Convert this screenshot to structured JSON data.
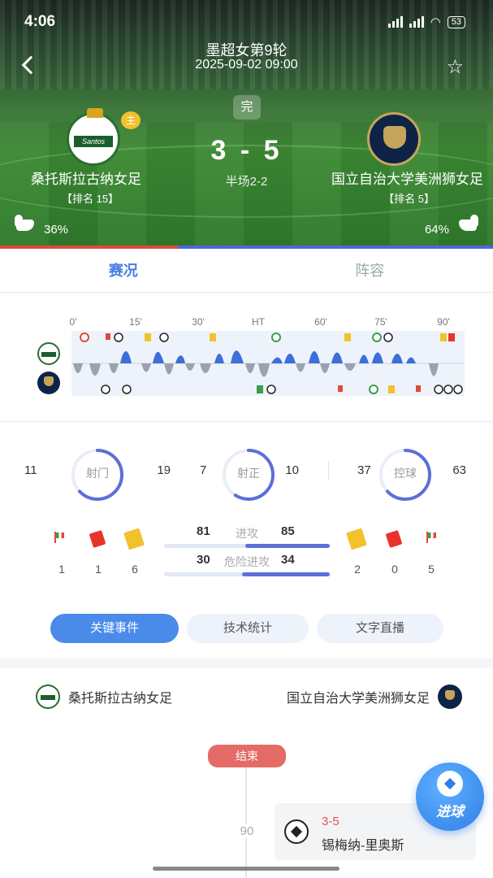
{
  "status_bar": {
    "time": "4:06",
    "battery": "53"
  },
  "header": {
    "league": "墨超女第9轮",
    "datetime": "2025-09-02 09:00",
    "status": "完",
    "score": "3 - 5",
    "halftime": "半场2-2",
    "home": {
      "name": "桑托斯拉古纳女足",
      "rank": "【排名 15】",
      "badge": "主",
      "strength_pct": "36%",
      "logo_text": "Santos"
    },
    "away": {
      "name": "国立自治大学美洲狮女足",
      "rank": "【排名 5】",
      "strength_pct": "64%"
    },
    "possession_split": {
      "home": 0.36,
      "away": 0.64
    }
  },
  "tabs": [
    {
      "label": "赛况",
      "active": true
    },
    {
      "label": "阵容",
      "active": false
    }
  ],
  "timeline": {
    "labels": [
      "0'",
      "15'",
      "30'",
      "HT",
      "60'",
      "75'",
      "90'"
    ]
  },
  "stats": {
    "rings": [
      {
        "label": "射门",
        "home": "11",
        "away": "19",
        "away_ratio": 0.63
      },
      {
        "label": "射正",
        "home": "7",
        "away": "10",
        "away_ratio": 0.59
      },
      {
        "label": "控球",
        "home": "37",
        "away": "63",
        "away_ratio": 0.63
      }
    ],
    "home_counts": {
      "corners": "1",
      "red_cards": "1",
      "yellow_cards": "6"
    },
    "away_counts": {
      "yellow_cards": "2",
      "red_cards": "0",
      "corners": "5"
    },
    "bars": [
      {
        "label": "进攻",
        "home": "81",
        "away": "85"
      },
      {
        "label": "危险进攻",
        "home": "30",
        "away": "34"
      }
    ]
  },
  "sub_tabs": [
    {
      "label": "关键事件",
      "active": true
    },
    {
      "label": "技术统计",
      "active": false
    },
    {
      "label": "文字直播",
      "active": false
    }
  ],
  "events": {
    "home_team": "桑托斯拉古纳女足",
    "away_team": "国立自治大学美洲狮女足",
    "end_label": "结束",
    "minute": "90",
    "goal": {
      "score": "3-5",
      "player": "锡梅纳-里奥斯"
    }
  },
  "fab": {
    "label": "进球"
  },
  "colors": {
    "accent": "#4a7de0",
    "home": "#e04a3a",
    "away": "#4f66d8"
  }
}
